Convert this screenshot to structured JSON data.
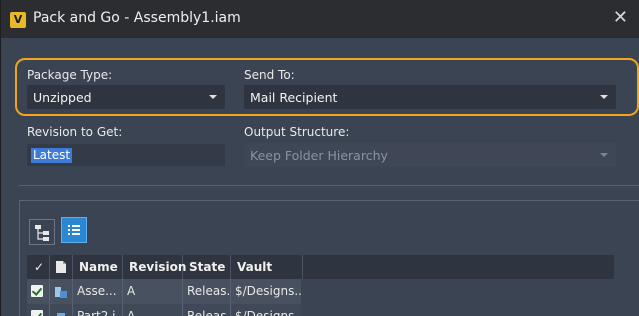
{
  "window": {
    "title": "Pack and Go - Assembly1.iam",
    "app_icon_letter": "V",
    "close_glyph": "✕"
  },
  "package_type": {
    "label": "Package Type:",
    "value": "Unzipped"
  },
  "send_to": {
    "label": "Send To:",
    "value": "Mail Recipient"
  },
  "revision": {
    "label": "Revision to Get:",
    "value": "Latest"
  },
  "output_structure": {
    "label": "Output Structure:",
    "value": "Keep Folder Hierarchy",
    "enabled": false
  },
  "toolbar": {
    "tree_view_icon": "tree-view-icon",
    "list_view_icon": "list-view-icon",
    "active_view": "list"
  },
  "grid": {
    "columns": [
      "✓",
      "",
      "Name",
      "Revision",
      "State",
      "Vault Path"
    ],
    "rows": [
      {
        "checked": true,
        "icon": "assembly-icon",
        "name": "Asse...",
        "revision": "A",
        "state": "Releas...",
        "path": "$/Designs..."
      },
      {
        "checked": true,
        "icon": "part-icon",
        "name": "Part2.i...",
        "revision": "A",
        "state": "Releas...",
        "path": "$/Designs..."
      }
    ]
  },
  "colors": {
    "highlight": "#f2a51a",
    "selection": "#3d7bd5",
    "accent": "#2a88d3"
  }
}
